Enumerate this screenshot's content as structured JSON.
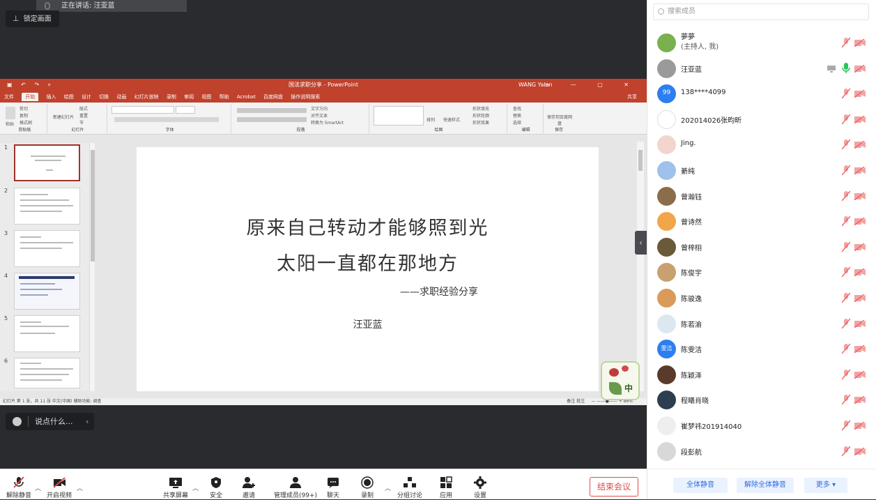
{
  "speaking": {
    "label": "正在讲话: 汪亚蓝"
  },
  "lock_screen": {
    "label": "锁定画面"
  },
  "ppt": {
    "title": "国法求职分享 - PowerPoint",
    "user": "WANG Yalan",
    "tabs": [
      "文件",
      "开始",
      "插入",
      "绘图",
      "设计",
      "切换",
      "动画",
      "幻灯片放映",
      "录制",
      "审阅",
      "视图",
      "帮助",
      "Acrobat",
      "百度网盘",
      "操作说明搜索"
    ],
    "share": "共享",
    "ribbon_groups": [
      "剪贴板",
      "幻灯片",
      "字体",
      "段落",
      "绘图",
      "编辑",
      "保存"
    ],
    "ribbon_items": {
      "cut": "剪切",
      "copy": "复制",
      "format_painter": "格式刷",
      "paste": "粘贴",
      "new_slide": "新建幻灯片",
      "layout": "版式",
      "reset": "重置",
      "section": "节",
      "text_direction": "文字方向",
      "align_text": "对齐文本",
      "smartart": "转换为 SmartArt",
      "arrange": "排列",
      "quick_styles": "快速样式",
      "shape_fill": "形状填充",
      "shape_outline": "形状轮廓",
      "shape_effects": "形状效果",
      "find": "查找",
      "replace": "替换",
      "select": "选择",
      "save_to_baidu": "保存到百度网盘"
    },
    "slide": {
      "line1": "原来自己转动才能够照到光",
      "line2": "太阳一直都在那地方",
      "line3": "——求职经验分享",
      "line4": "汪亚蓝"
    },
    "thumbs": [
      "1",
      "2",
      "3",
      "4",
      "5",
      "6"
    ],
    "status_left": "幻灯片 第 1 张，共 11 张    中文(中国)    辅助功能: 调查",
    "status_right": "备注   批注",
    "zoom": "86%"
  },
  "ime": {
    "label": "中"
  },
  "chat": {
    "placeholder": "说点什么..."
  },
  "toolbar": {
    "unmute": "解除静音",
    "video": "开启视频",
    "share": "共享屏幕",
    "security": "安全",
    "invite": "邀请",
    "members": "管理成员(99+)",
    "chat": "聊天",
    "record": "录制",
    "breakout": "分组讨论",
    "apps": "应用",
    "settings": "设置",
    "end": "结束会议"
  },
  "panel": {
    "search_placeholder": "搜索成员",
    "members": [
      {
        "name": "夢夢",
        "sub": "(主持人, 我)"
      },
      {
        "name": "汪亚蓝",
        "sub": ""
      },
      {
        "name": "138****4099",
        "sub": ""
      },
      {
        "name": "202014026张昀昕",
        "sub": ""
      },
      {
        "name": "Jing.",
        "sub": ""
      },
      {
        "name": "綦纯",
        "sub": ""
      },
      {
        "name": "曾瀚钰",
        "sub": ""
      },
      {
        "name": "曾诗然",
        "sub": ""
      },
      {
        "name": "曾梓栩",
        "sub": ""
      },
      {
        "name": "陈俊宇",
        "sub": ""
      },
      {
        "name": "陈骏逸",
        "sub": ""
      },
      {
        "name": "陈若渝",
        "sub": ""
      },
      {
        "name": "陈雯洁",
        "sub": ""
      },
      {
        "name": "陈颖泽",
        "sub": ""
      },
      {
        "name": "程曦肖晓",
        "sub": ""
      },
      {
        "name": "崔梦祎201914040",
        "sub": ""
      },
      {
        "name": "段彭航",
        "sub": ""
      }
    ],
    "avatar_99": "99",
    "avatar_wenjie": "雯洁",
    "mute_all": "全体静音",
    "unmute_all": "解除全体静音",
    "more": "更多 ▾"
  },
  "colors": {
    "ppt_accent": "#c0412c",
    "end_red": "#e04a4a",
    "link_blue": "#2d6ee0",
    "mic_on": "#29c45e",
    "muted_red": "#e66"
  }
}
